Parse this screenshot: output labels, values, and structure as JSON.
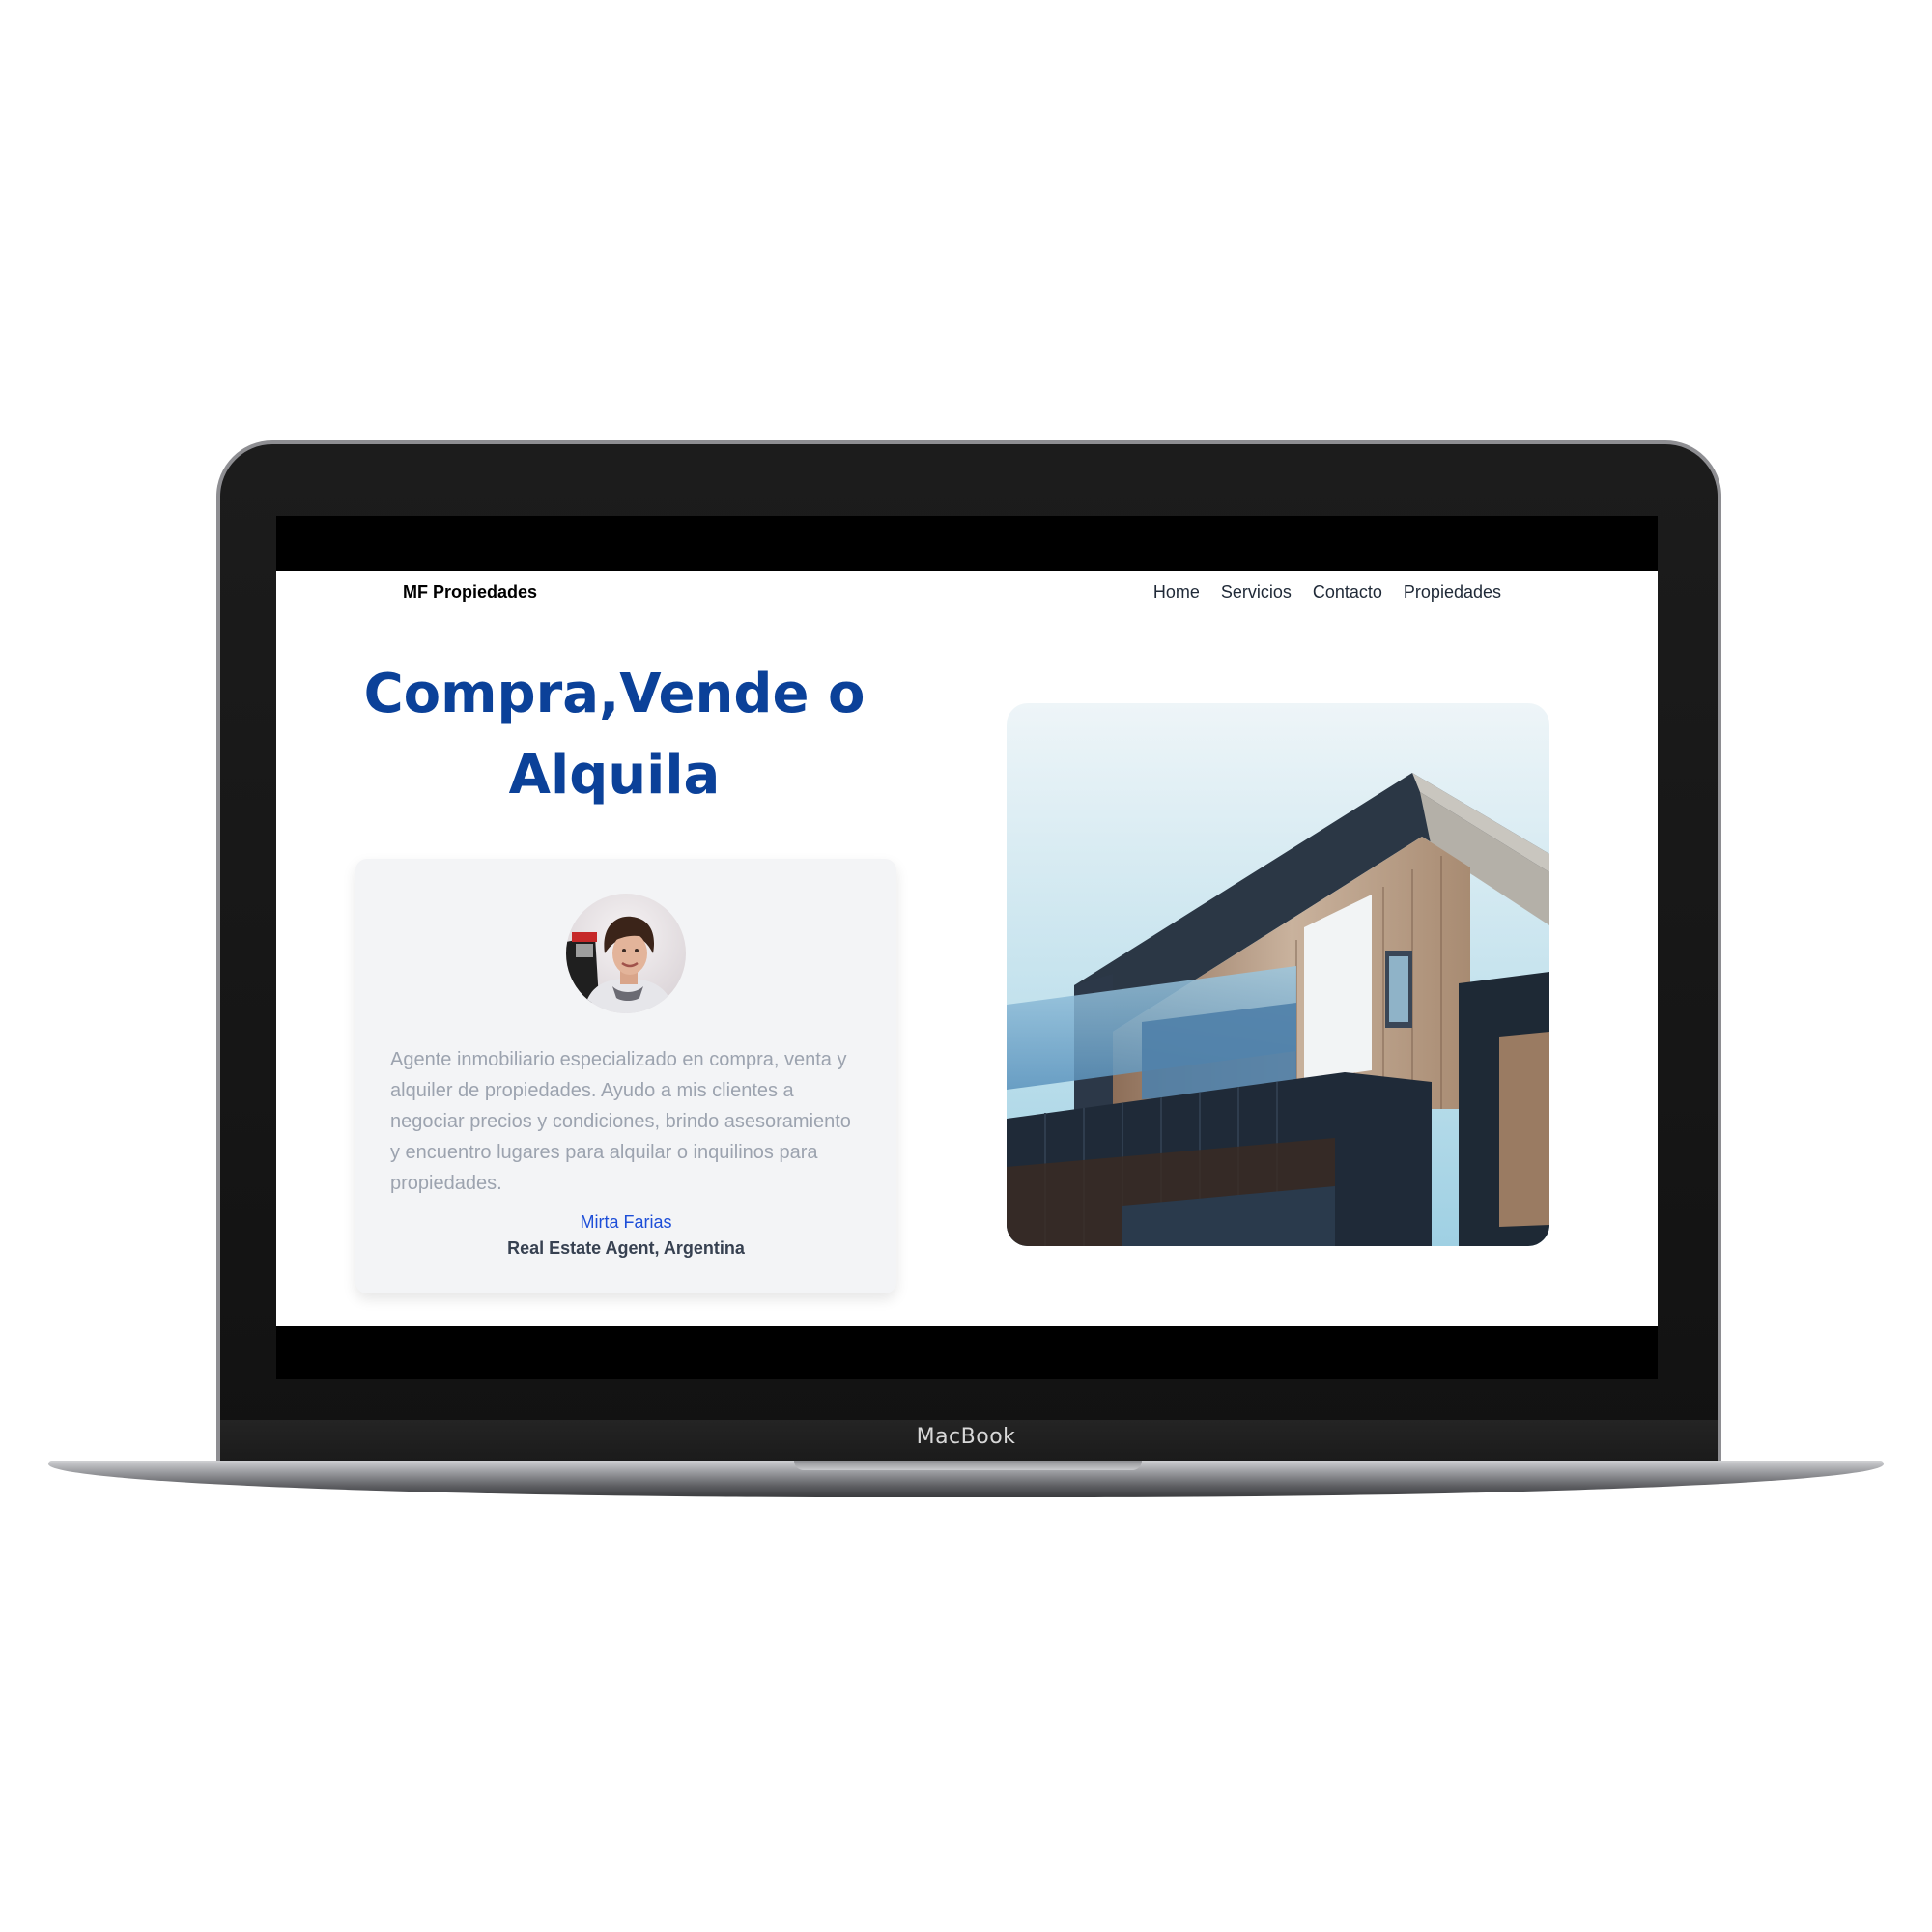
{
  "device": {
    "brand_label": "MacBook"
  },
  "site": {
    "logo": "MF Propiedades",
    "nav": [
      "Home",
      "Servicios",
      "Contacto",
      "Propiedades"
    ]
  },
  "hero": {
    "title_line1": "Compra,Vende o",
    "title_line2": "Alquila",
    "image_icon": "modern-house-photo"
  },
  "testimonial": {
    "avatar_icon": "agent-portrait-photo",
    "text": "Agente inmobiliario especializado en compra, venta y alquiler de propiedades. Ayudo a mis clientes a negociar precios y condiciones, brindo asesoramiento y encuentro lugares para alquilar o inquilinos para propiedades.",
    "name": "Mirta Farias",
    "role": "Real Estate Agent, Argentina"
  },
  "colors": {
    "accent": "#0b4199",
    "name_link": "#1d4ed8",
    "card_bg": "#f3f4f6",
    "body_text": "#9ca3af"
  }
}
